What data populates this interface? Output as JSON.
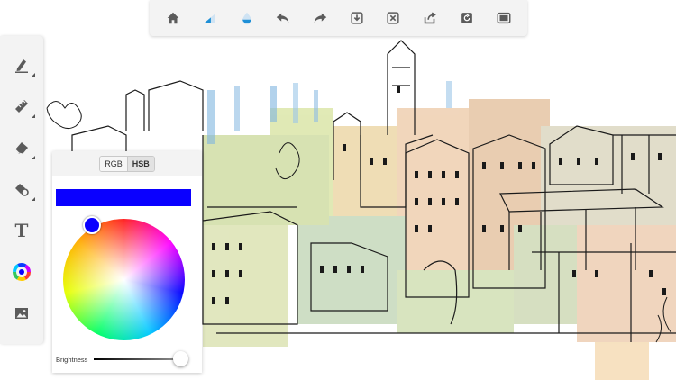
{
  "colors": {
    "toolbar_bg": "#f3f3f3",
    "icon": "#5b5b5b",
    "accent_blue": "#1e8fd6",
    "current_color": "#0a00ff"
  },
  "top_toolbar": {
    "buttons": [
      {
        "icon": "home-icon"
      },
      {
        "icon": "brush-size-icon"
      },
      {
        "icon": "opacity-drop-icon"
      },
      {
        "icon": "undo-icon"
      },
      {
        "icon": "redo-icon"
      },
      {
        "icon": "download-icon"
      },
      {
        "icon": "clear-icon"
      },
      {
        "icon": "share-icon"
      },
      {
        "icon": "rotate-icon"
      },
      {
        "icon": "fullscreen-icon"
      }
    ]
  },
  "left_toolbar": {
    "tools": [
      {
        "icon": "pen-icon"
      },
      {
        "icon": "ruler-icon"
      },
      {
        "icon": "eraser-icon"
      },
      {
        "icon": "shape-fill-icon"
      },
      {
        "icon": "text-icon",
        "glyph": "T"
      },
      {
        "icon": "color-wheel-icon"
      },
      {
        "icon": "image-layer-icon"
      }
    ]
  },
  "color_panel": {
    "tabs": [
      "RGB",
      "HSB"
    ],
    "active_tab": "HSB",
    "brightness_label": "Brightness",
    "brightness": 1.0
  }
}
